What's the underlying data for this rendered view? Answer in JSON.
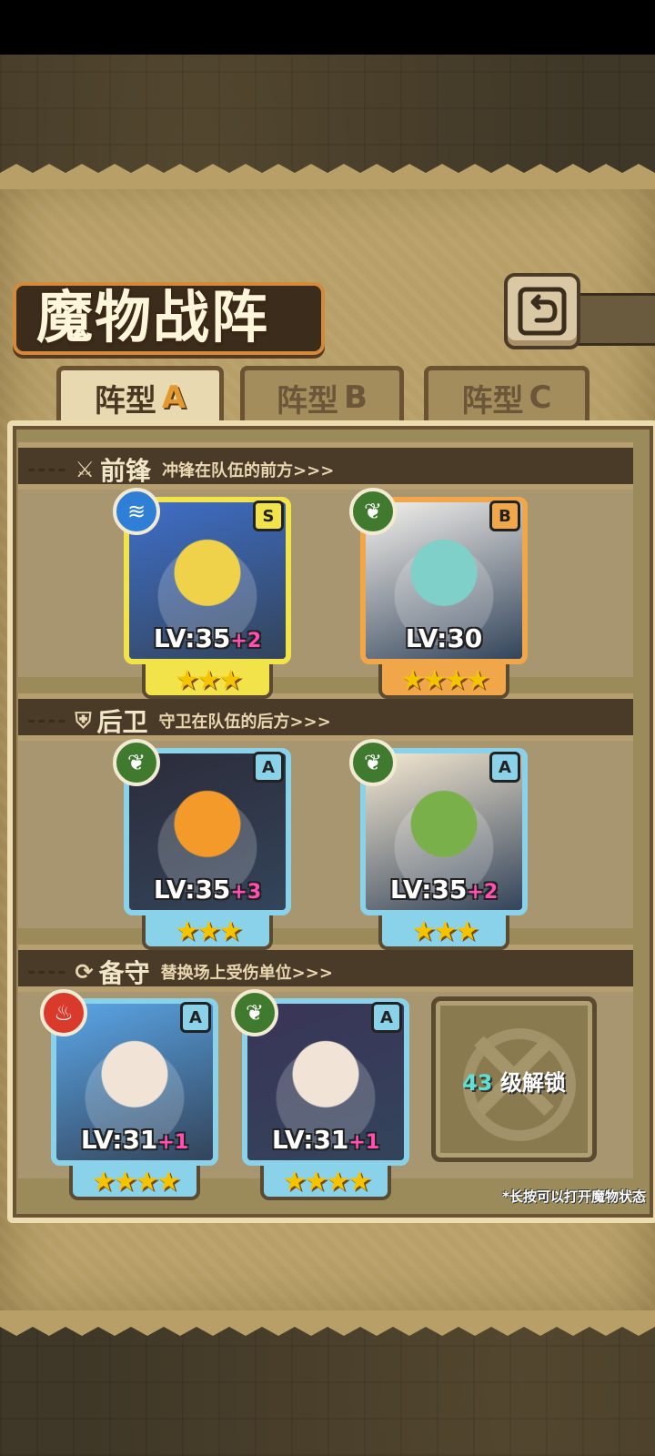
{
  "title": "魔物战阵",
  "tabs": [
    {
      "label": "阵型",
      "letter": "A",
      "active": true
    },
    {
      "label": "阵型",
      "letter": "B",
      "active": false
    },
    {
      "label": "阵型",
      "letter": "C",
      "active": false
    }
  ],
  "sections": {
    "front": {
      "name": "前锋",
      "desc": "冲锋在队伍的前方>>>"
    },
    "rear": {
      "name": "后卫",
      "desc": "守卫在队伍的后方>>>"
    },
    "reserve": {
      "name": "备守",
      "desc": "替换场上受伤单位>>>"
    }
  },
  "cards": [
    {
      "rank": "S",
      "element": "water",
      "lv": "LV:35",
      "plus": "+2",
      "stars": "★★★",
      "frame": "#f2e34a"
    },
    {
      "rank": "B",
      "element": "leaf",
      "lv": "LV:30",
      "plus": "",
      "stars": "★★★★",
      "frame": "#f2a64a"
    },
    {
      "rank": "A",
      "element": "leaf",
      "lv": "LV:35",
      "plus": "+3",
      "stars": "★★★",
      "frame": "#8ad2ea"
    },
    {
      "rank": "A",
      "element": "leaf",
      "lv": "LV:35",
      "plus": "+2",
      "stars": "★★★",
      "frame": "#8ad2ea"
    },
    {
      "rank": "A",
      "element": "fire",
      "lv": "LV:31",
      "plus": "+1",
      "stars": "★★★★",
      "frame": "#8ad2ea"
    },
    {
      "rank": "A",
      "element": "leaf",
      "lv": "LV:31",
      "plus": "+1",
      "stars": "★★★★",
      "frame": "#8ad2ea"
    }
  ],
  "locked_slot": {
    "level": "43",
    "text": "级解锁"
  },
  "hint": "*长按可以打开魔物状态",
  "dashes": "----",
  "colors": {
    "water": "#2f7fd6",
    "leaf": "#3f7a2e",
    "fire": "#d93a2b"
  }
}
